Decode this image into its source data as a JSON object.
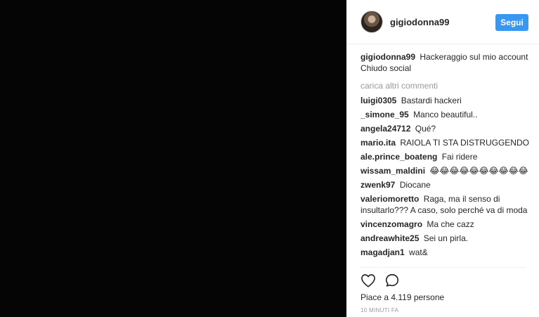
{
  "post": {
    "author": "gigiodonna99",
    "follow_label": "Segui",
    "caption": {
      "user": "gigiodonna99",
      "text": "Hackeraggio sul mio account Chiudo social"
    },
    "load_more_label": "carica altri commenti",
    "comments": [
      {
        "user": "luigi0305",
        "text": "Bastardi hackeri"
      },
      {
        "user": "_simone_95",
        "text": "Manco beautiful.."
      },
      {
        "user": "angela24712",
        "text": "Qué?"
      },
      {
        "user": "mario.ita",
        "text": "RAIOLA TI STA DISTRUGGENDO"
      },
      {
        "user": "ale.prince_boateng",
        "text": "Fai ridere"
      },
      {
        "user": "wissam_maldini",
        "text": "😂😂😂😂😂😂😂😂😂😂"
      },
      {
        "user": "zwenk97",
        "text": "Diocane"
      },
      {
        "user": "valeriomoretto",
        "text": "Raga, ma il senso di insultarlo??? A caso, solo perché va di moda"
      },
      {
        "user": "vincenzomagro",
        "text": "Ma che cazz"
      },
      {
        "user": "andreawhite25",
        "text": "Sei un pirla."
      },
      {
        "user": "magadjan1",
        "text": "wat&"
      }
    ],
    "likes_text": "Piace a 4.119 persone",
    "timestamp": "10 MINUTI FA"
  },
  "icons": {
    "like": "heart-icon",
    "comment": "comment-bubble-icon"
  },
  "colors": {
    "accent": "#3897f0",
    "media_background": "#050505",
    "muted_text": "#999999"
  }
}
